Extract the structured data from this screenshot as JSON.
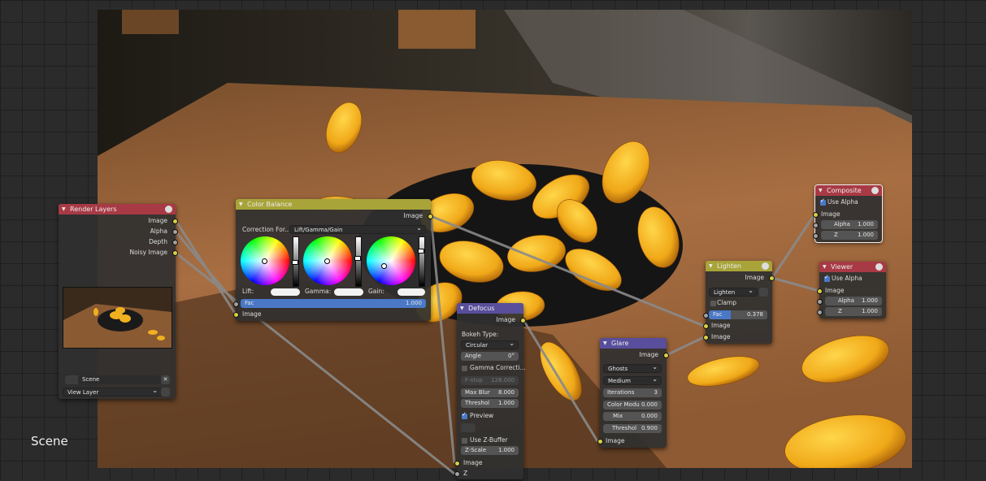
{
  "colors": {
    "image_socket": "#d8d044",
    "value_socket": "#a1a1a1",
    "input_header": "#a83a45",
    "color_header": "#a8a43a",
    "filter_header": "#584e9c",
    "link": "#8a8a8a",
    "accent_bar": "#4a78c6"
  },
  "workspace": {
    "label": "Scene"
  },
  "render_layers": {
    "title": "Render Layers",
    "outputs": [
      "Image",
      "Alpha",
      "Depth",
      "Noisy Image"
    ],
    "scene_value": "Scene",
    "layer_value": "View Layer"
  },
  "color_balance": {
    "title": "Color Balance",
    "output": "Image",
    "correction_label": "Correction For...",
    "correction_value": "Lift/Gamma/Gain",
    "wheels": [
      "Lift:",
      "Gamma:",
      "Gain:"
    ],
    "fac_label": "Fac",
    "fac_value": "1.000",
    "input": "Image"
  },
  "defocus": {
    "title": "Defocus",
    "output": "Image",
    "bokeh_label": "Bokeh Type:",
    "bokeh_value": "Circular",
    "angle_label": "Angle",
    "angle_value": "0°",
    "gamma_label": "Gamma Correcti...",
    "fstop_label": "F-stop",
    "fstop_value": "128.000",
    "maxblur_label": "Max Blur",
    "maxblur_value": "8.000",
    "threshold_label": "Threshol",
    "threshold_value": "1.000",
    "preview_label": "Preview",
    "zbuffer_label": "Use Z-Buffer",
    "zscale_label": "Z-Scale",
    "zscale_value": "1.000",
    "inputs": [
      "Image",
      "Z"
    ]
  },
  "glare": {
    "title": "Glare",
    "output": "Image",
    "type_value": "Ghosts",
    "quality_value": "Medium",
    "iterations_label": "Iterations",
    "iterations_value": "3",
    "colormod_label": "Color Modu",
    "colormod_value": "0.000",
    "mix_label": "Mix",
    "mix_value": "0.000",
    "threshold_label": "Threshol",
    "threshold_value": "0.900",
    "input": "Image"
  },
  "lighten": {
    "title": "Lighten",
    "output": "Image",
    "blend_value": "Lighten",
    "clamp_label": "Clamp",
    "fac_label": "Fac",
    "fac_value": "0.378",
    "inputs": [
      "Image",
      "Image"
    ]
  },
  "composite": {
    "title": "Composite",
    "use_alpha_label": "Use Alpha",
    "image_label": "Image",
    "alpha_label": "Alpha",
    "alpha_value": "1.000",
    "z_label": "Z",
    "z_value": "1.000"
  },
  "viewer": {
    "title": "Viewer",
    "use_alpha_label": "Use Alpha",
    "image_label": "Image",
    "alpha_label": "Alpha",
    "alpha_value": "1.000",
    "z_label": "Z",
    "z_value": "1.000"
  }
}
